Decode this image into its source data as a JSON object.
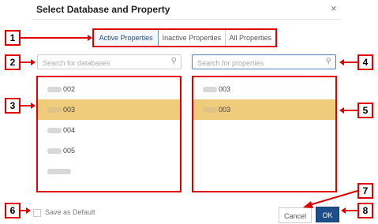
{
  "dialog": {
    "title": "Select Database and Property",
    "close_icon": "×"
  },
  "tabs": [
    "Active Properties",
    "Inactive Properties",
    "All Properties"
  ],
  "db_search": {
    "placeholder": "Search for databases"
  },
  "prop_search": {
    "placeholder": "Search for properties"
  },
  "databases": [
    "002",
    "003",
    "004",
    "005",
    ""
  ],
  "properties": [
    "003",
    "003"
  ],
  "save_default_label": "Save as Default",
  "buttons": {
    "cancel": "Cancel",
    "ok": "OK"
  },
  "callouts": [
    "1",
    "2",
    "3",
    "4",
    "5",
    "6",
    "7",
    "8"
  ],
  "icons": {
    "search": "search-icon",
    "close": "close-icon"
  },
  "colors": {
    "accent": "#1f4e8c",
    "selection": "#efcb7c",
    "callout": "#e00000"
  }
}
